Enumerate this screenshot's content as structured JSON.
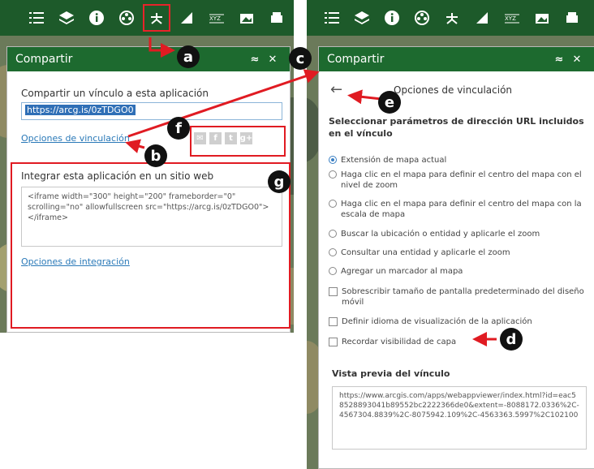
{
  "toolbar": {
    "icons": [
      "list-icon",
      "layers-icon",
      "info-icon",
      "film-reel-icon",
      "share-icon",
      "measure-icon",
      "xyz-icon",
      "basemap-icon",
      "print-icon"
    ]
  },
  "left_panel": {
    "title": "Compartir",
    "share_link_heading": "Compartir un vínculo a esta aplicación",
    "share_url": "https://arcg.is/0zTDGO0",
    "link_options": "Opciones de vinculación",
    "socials": [
      "✉",
      "f",
      "t",
      "g+"
    ],
    "embed_heading": "Integrar esta aplicación en un sitio web",
    "embed_code": "<iframe width=\"300\" height=\"200\" frameborder=\"0\" scrolling=\"no\" allowfullscreen src=\"https://arcg.is/0zTDGO0\"></iframe>",
    "embed_options": "Opciones de integración"
  },
  "right_panel": {
    "title": "Compartir",
    "back_arrow": "←",
    "heading": "Opciones de vinculación",
    "params_heading": "Seleccionar parámetros de dirección URL incluidos en el vínculo",
    "radio_options": [
      "Extensión de mapa actual",
      "Haga clic en el mapa para definir el centro del mapa con el nivel de zoom",
      "Haga clic en el mapa para definir el centro del mapa con la escala de mapa",
      "Buscar la ubicación o entidad y aplicarle el zoom",
      "Consultar una entidad y aplicarle el zoom",
      "Agregar un marcador al mapa"
    ],
    "checkbox_options": [
      "Sobrescribir tamaño de pantalla predeterminado del diseño móvil",
      "Definir idioma de visualización de la aplicación",
      "Recordar visibilidad de capa"
    ],
    "preview_heading": "Vista previa del vínculo",
    "preview_url": "https://www.arcgis.com/apps/webappviewer/index.html?id=eac58528893041b89552bc2222366de0&extent=-8088172.0336%2C-4567304.8839%2C-8075942.109%2C-4563363.5997%2C102100"
  },
  "header_controls": {
    "collapse": "≈",
    "close": "✕"
  },
  "annotations": [
    "a",
    "b",
    "c",
    "d",
    "e",
    "f",
    "g"
  ],
  "colors": {
    "header_green": "#1d6a2f",
    "toolbar_green": "#1d5a2a",
    "annotation_red": "#e01b22",
    "link_blue": "#2a79b8"
  }
}
